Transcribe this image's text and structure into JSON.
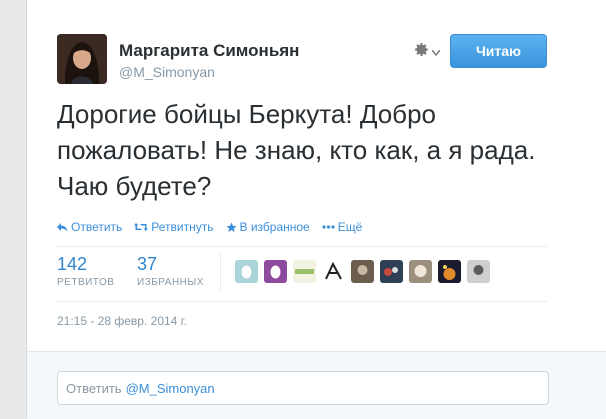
{
  "author": {
    "name": "Маргарита Симоньян",
    "handle": "@M_Simonyan"
  },
  "follow_button": {
    "label": "Читаю"
  },
  "tweet": {
    "text": "Дорогие бойцы Беркута! Добро пожаловать! Не знаю, кто как, а я рада. Чаю будете?"
  },
  "actions": {
    "reply": "Ответить",
    "retweet": "Ретвитнуть",
    "favorite": "В избранное",
    "more": "Ещё"
  },
  "stats": {
    "retweets": {
      "count": "142",
      "label": "РЕТВИТОВ"
    },
    "favorites": {
      "count": "37",
      "label": "ИЗБРАННЫХ"
    }
  },
  "timestamp": "21:15 - 28 февр. 2014 г.",
  "reply_box": {
    "placeholder": "Ответить",
    "mention": "@M_Simonyan"
  },
  "colors": {
    "link": "#3b8fd9",
    "follow_button": "#3a94dd",
    "muted": "#8899a6"
  },
  "icons": {
    "settings": "gear-icon",
    "reply": "reply-arrow-icon",
    "retweet": "retweet-icon",
    "favorite": "star-icon",
    "more": "ellipsis-icon"
  }
}
